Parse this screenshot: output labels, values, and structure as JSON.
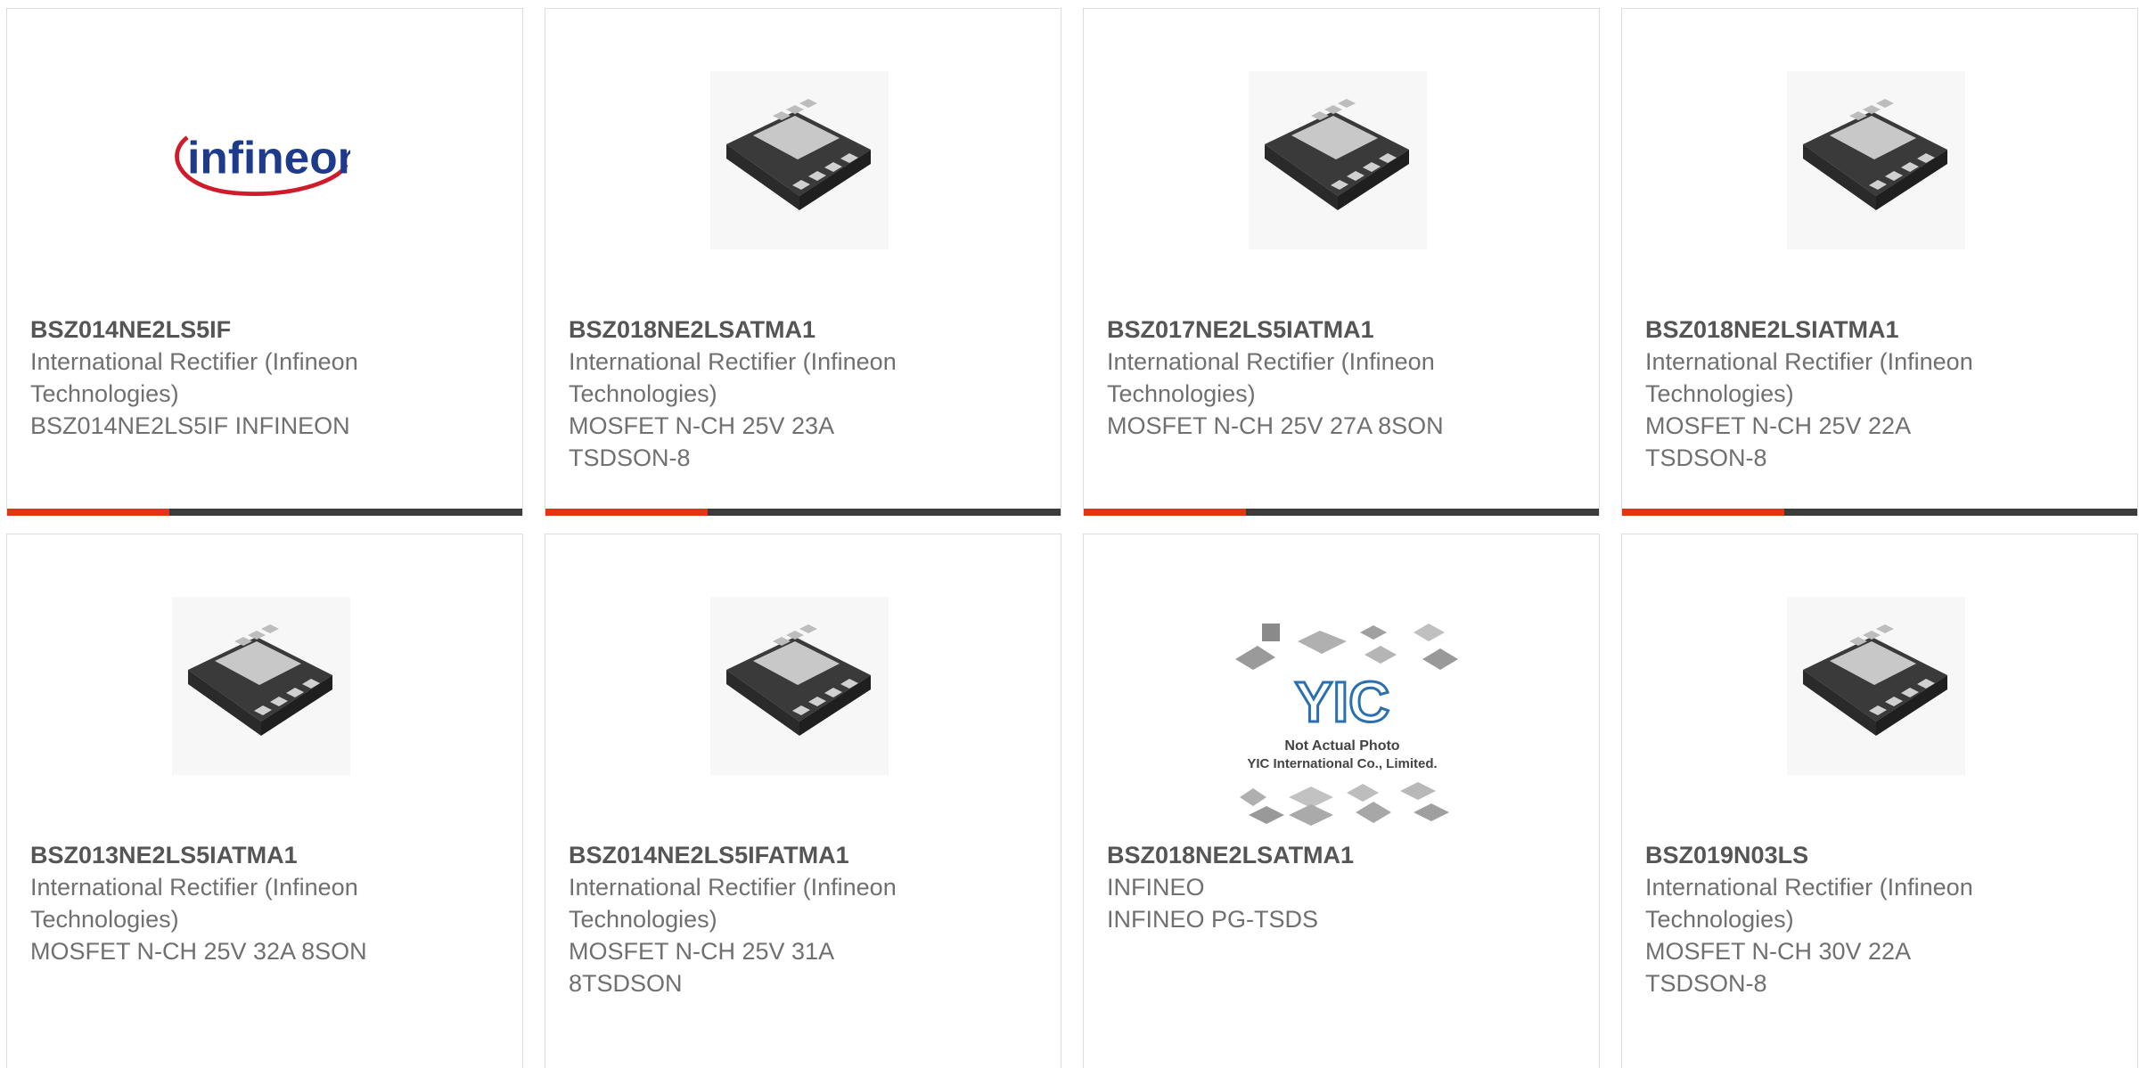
{
  "accent_color": "#e63312",
  "bar_color": "#3b3b3b",
  "cards": [
    {
      "part": "BSZ014NE2LS5IF",
      "line1": "International Rectifier (Infineon",
      "line2": "Technologies)",
      "line3": "BSZ014NE2LS5IF INFINEON",
      "line4": "",
      "image": "infineon-logo"
    },
    {
      "part": "BSZ018NE2LSATMA1",
      "line1": "International Rectifier (Infineon",
      "line2": "Technologies)",
      "line3": "MOSFET N-CH 25V 23A",
      "line4": "TSDSON-8",
      "image": "chip-package"
    },
    {
      "part": "BSZ017NE2LS5IATMA1",
      "line1": "International Rectifier (Infineon",
      "line2": "Technologies)",
      "line3": "MOSFET N-CH 25V 27A 8SON",
      "line4": "",
      "image": "chip-package"
    },
    {
      "part": "BSZ018NE2LSIATMA1",
      "line1": "International Rectifier (Infineon",
      "line2": "Technologies)",
      "line3": "MOSFET N-CH 25V 22A",
      "line4": "TSDSON-8",
      "image": "chip-package"
    },
    {
      "part": "BSZ013NE2LS5IATMA1",
      "line1": "International Rectifier (Infineon",
      "line2": "Technologies)",
      "line3": "MOSFET N-CH 25V 32A 8SON",
      "line4": "",
      "image": "chip-package"
    },
    {
      "part": "BSZ014NE2LS5IFATMA1",
      "line1": "International Rectifier (Infineon",
      "line2": "Technologies)",
      "line3": "MOSFET N-CH 25V 31A",
      "line4": "8TSDSON",
      "image": "chip-package"
    },
    {
      "part": "BSZ018NE2LSATMA1",
      "line1": "INFINEO",
      "line2": "INFINEO PG-TSDS",
      "line3": "",
      "line4": "",
      "image": "placeholder-photo",
      "placeholder_text1": "Not Actual Photo",
      "placeholder_text2": "YIC International Co., Limited.",
      "placeholder_logo": "YIC"
    },
    {
      "part": "BSZ019N03LS",
      "line1": "International Rectifier (Infineon",
      "line2": "Technologies)",
      "line3": "MOSFET N-CH 30V 22A",
      "line4": "TSDSON-8",
      "image": "chip-package"
    }
  ],
  "logo_text": "infineon"
}
